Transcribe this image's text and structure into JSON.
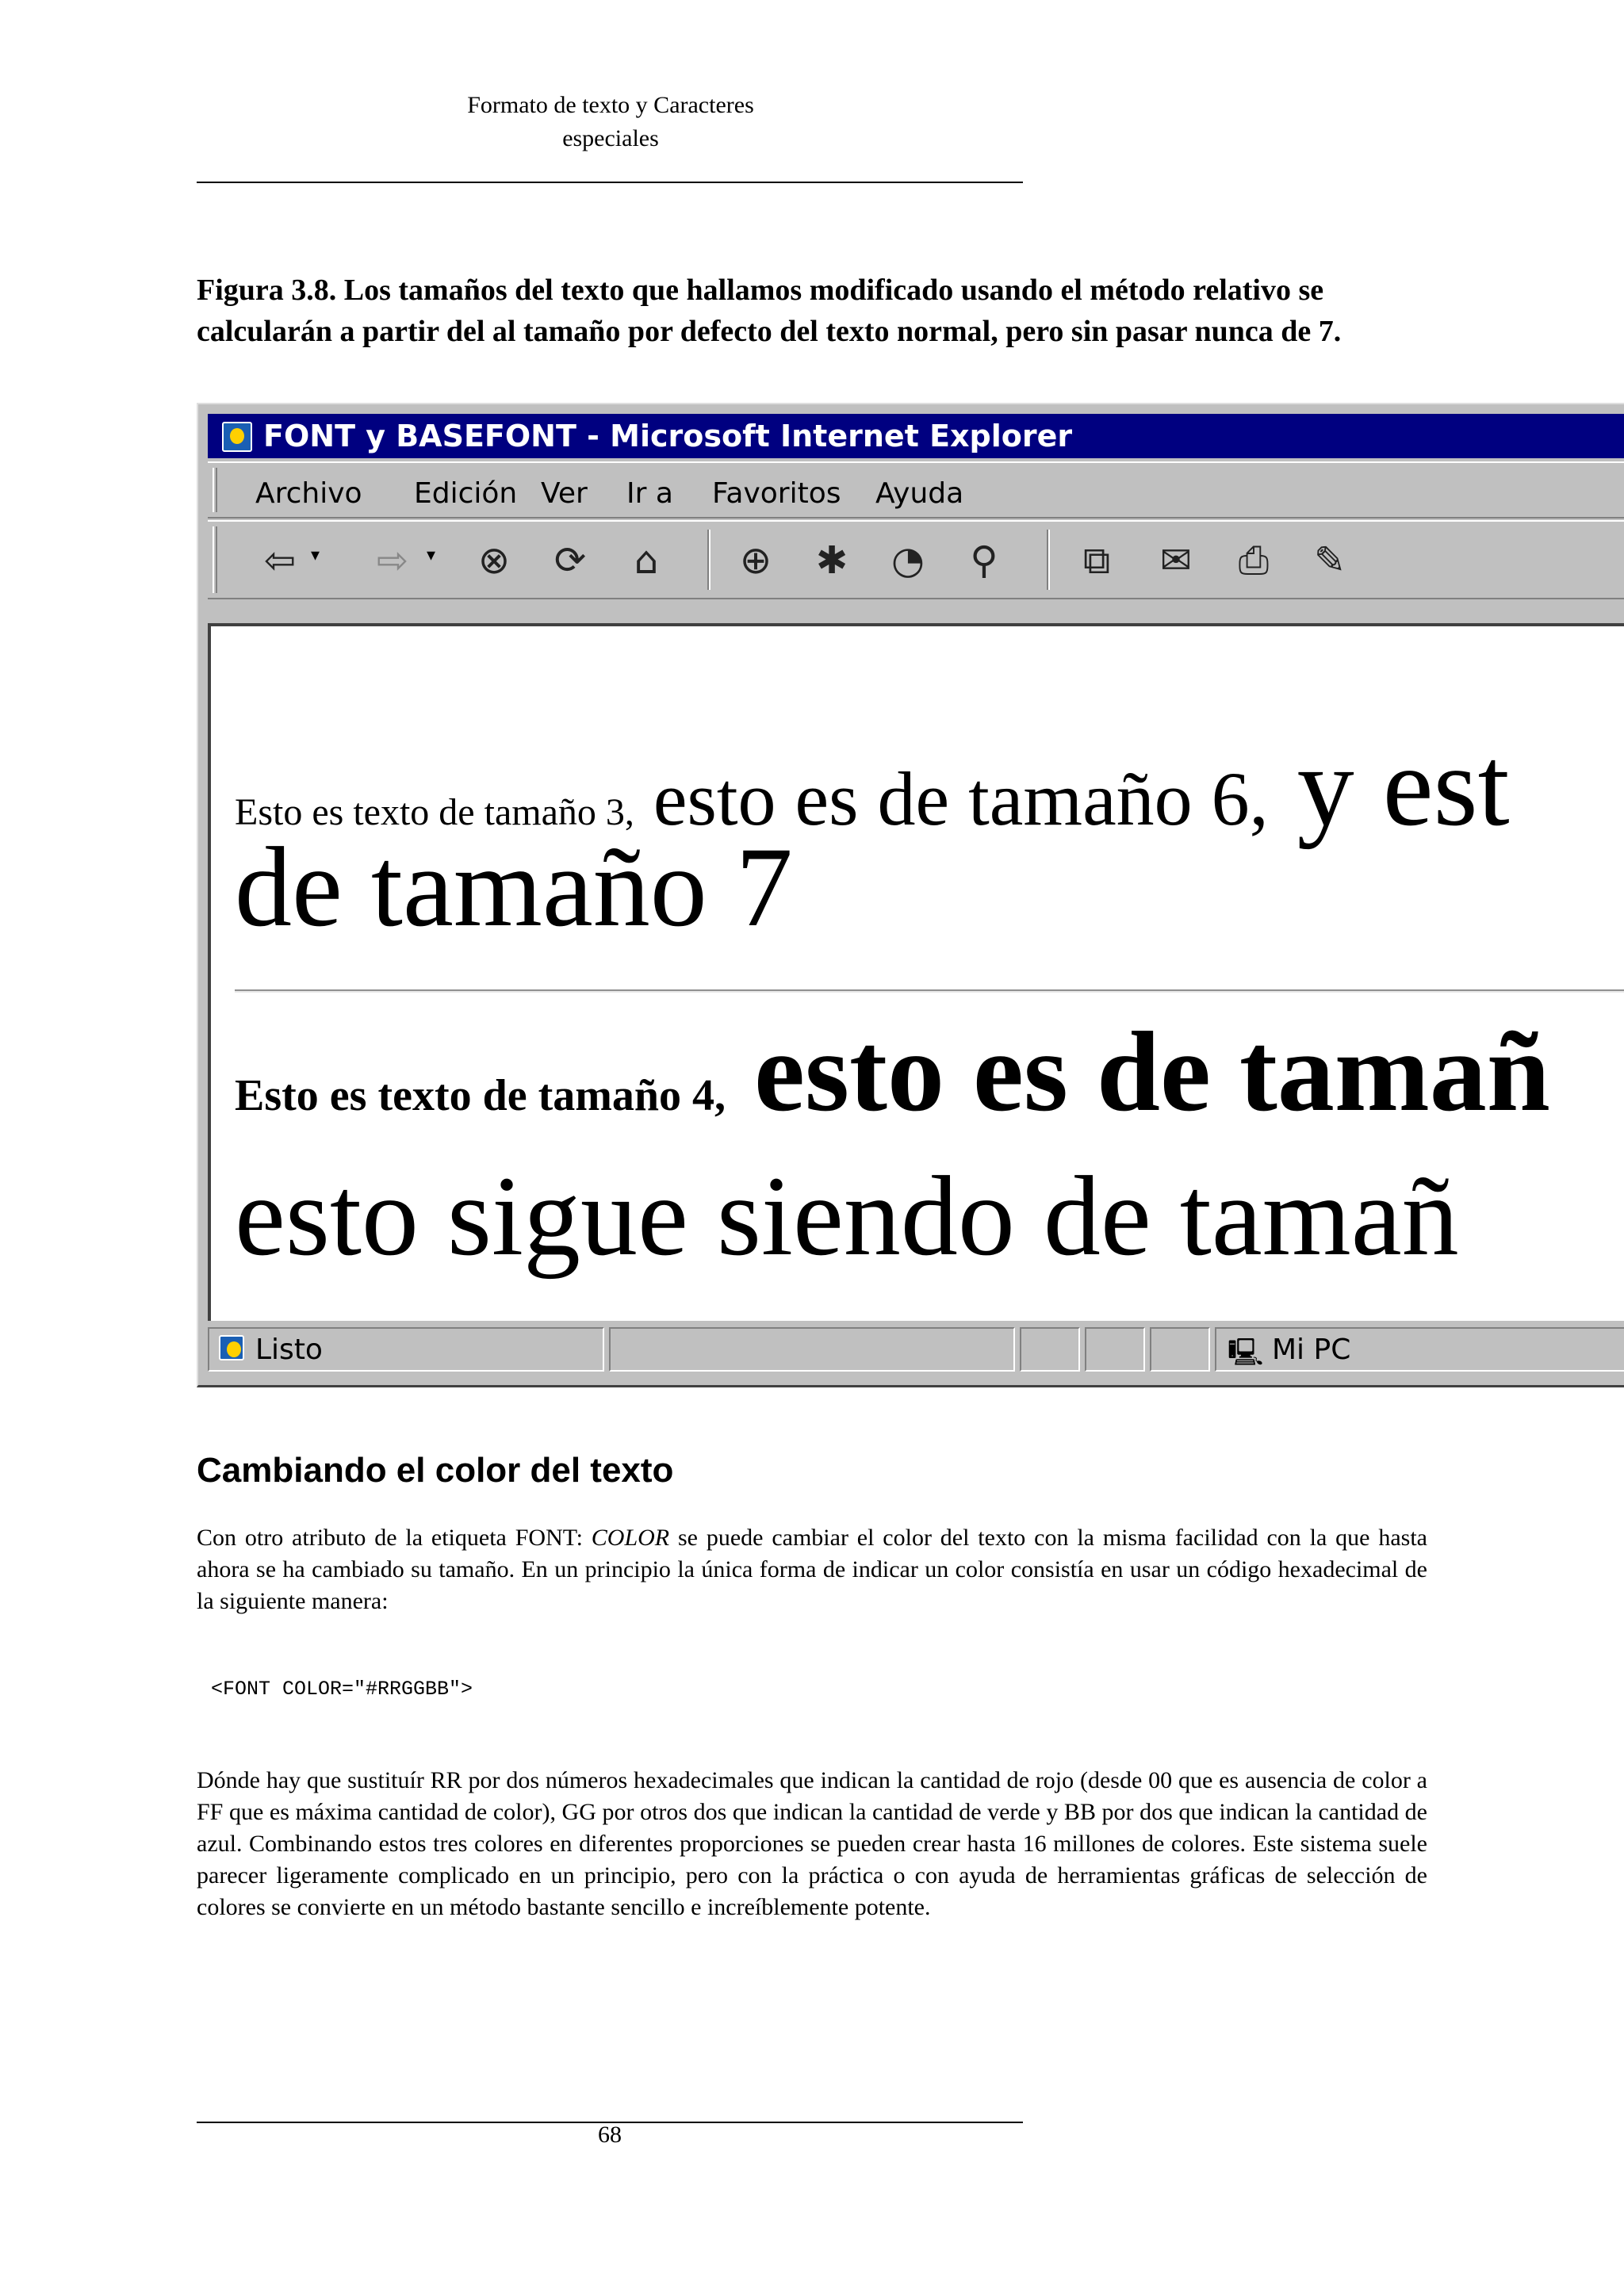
{
  "header": {
    "line1": "Formato de texto y Caracteres",
    "line2": "especiales"
  },
  "caption": "Figura 3.8. Los tamaños del texto que hallamos modificado usando el método relativo se calcularán a partir del al tamaño por defecto del texto normal, pero sin pasar nunca de 7.",
  "browser": {
    "title": "FONT y BASEFONT - Microsoft Internet Explorer",
    "menu": [
      "Archivo",
      "Edición",
      "Ver",
      "Ir a",
      "Favoritos",
      "Ayuda"
    ],
    "toolbar_icons": [
      "back-icon",
      "forward-icon",
      "stop-icon",
      "refresh-icon",
      "home-icon",
      "search-icon",
      "favorites-icon",
      "history-icon",
      "channels-icon",
      "fullscreen-icon",
      "mail-icon",
      "print-icon",
      "edit-icon"
    ],
    "content": {
      "line1_a": "Esto es texto de tamaño 3,",
      "line1_b": " esto es de tamaño 6,",
      "line1_c": " y est",
      "line2": "de tamaño 7",
      "line3_a": "Esto es texto de tamaño 4,",
      "line3_b": " esto es de tamañ",
      "line4": "esto sigue siendo de tamañ"
    },
    "status": {
      "text": "Listo",
      "zone": "Mi PC"
    }
  },
  "section_title": "Cambiando el color del texto",
  "para1": "Con otro atributo de la etiqueta FONT: ",
  "para1_em": "COLOR",
  "para1_rest": " se puede cambiar el color del texto con la misma facilidad con la que hasta ahora se ha cambiado su tamaño.  En un principio la única forma de indicar un color consistía en usar un código hexadecimal de la siguiente manera:",
  "code": "<FONT COLOR=\"#RRGGBB\">",
  "para2": "Dónde hay que sustituír RR por dos números hexadecimales  que indican la cantidad de rojo (desde 00 que es ausencia de color a FF que es máxima cantidad de color), GG por otros dos que indican la cantidad de verde y BB por dos que indican la cantidad de azul. Combinando estos tres colores en diferentes proporciones se pueden crear hasta 16 millones de colores. Este sistema suele parecer ligeramente complicado en un principio, pero con la práctica o con ayuda de herramientas gráficas de selección de colores se convierte en un método bastante sencillo e increíblemente potente.",
  "page_number": "68"
}
